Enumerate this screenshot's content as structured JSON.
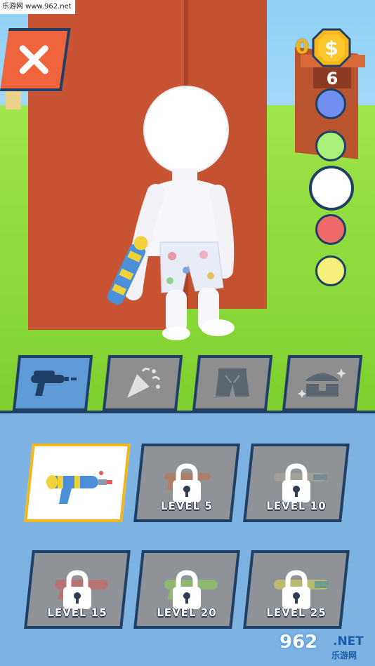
{
  "hud": {
    "coins": "0",
    "pillar_number": "6",
    "colors": [
      {
        "name": "blue",
        "hex": "#6f8ef0"
      },
      {
        "name": "green",
        "hex": "#a8f07a"
      },
      {
        "name": "white",
        "hex": "#ffffff",
        "selected": true
      },
      {
        "name": "red",
        "hex": "#f06a6a"
      },
      {
        "name": "yellow",
        "hex": "#f5f07a"
      }
    ]
  },
  "tabs": [
    {
      "icon": "water-gun-icon",
      "active": true
    },
    {
      "icon": "party-popper-icon",
      "active": false
    },
    {
      "icon": "shorts-icon",
      "active": false
    },
    {
      "icon": "treasure-chest-icon",
      "active": false
    }
  ],
  "items": [
    {
      "id": "gun-1",
      "locked": false,
      "selected": true,
      "label": ""
    },
    {
      "id": "gun-2",
      "locked": true,
      "label": "LEVEL 5"
    },
    {
      "id": "gun-3",
      "locked": true,
      "label": "LEVEL 10"
    },
    {
      "id": "gun-4",
      "locked": true,
      "label": "LEVEL 15"
    },
    {
      "id": "gun-5",
      "locked": true,
      "label": "LEVEL 20"
    },
    {
      "id": "gun-6",
      "locked": true,
      "label": "LEVEL 25"
    }
  ],
  "watermark": {
    "top": "乐游网 www.962.net",
    "bottom_num": "962",
    "bottom_net": ".NET",
    "bottom_cn": "乐游网"
  }
}
